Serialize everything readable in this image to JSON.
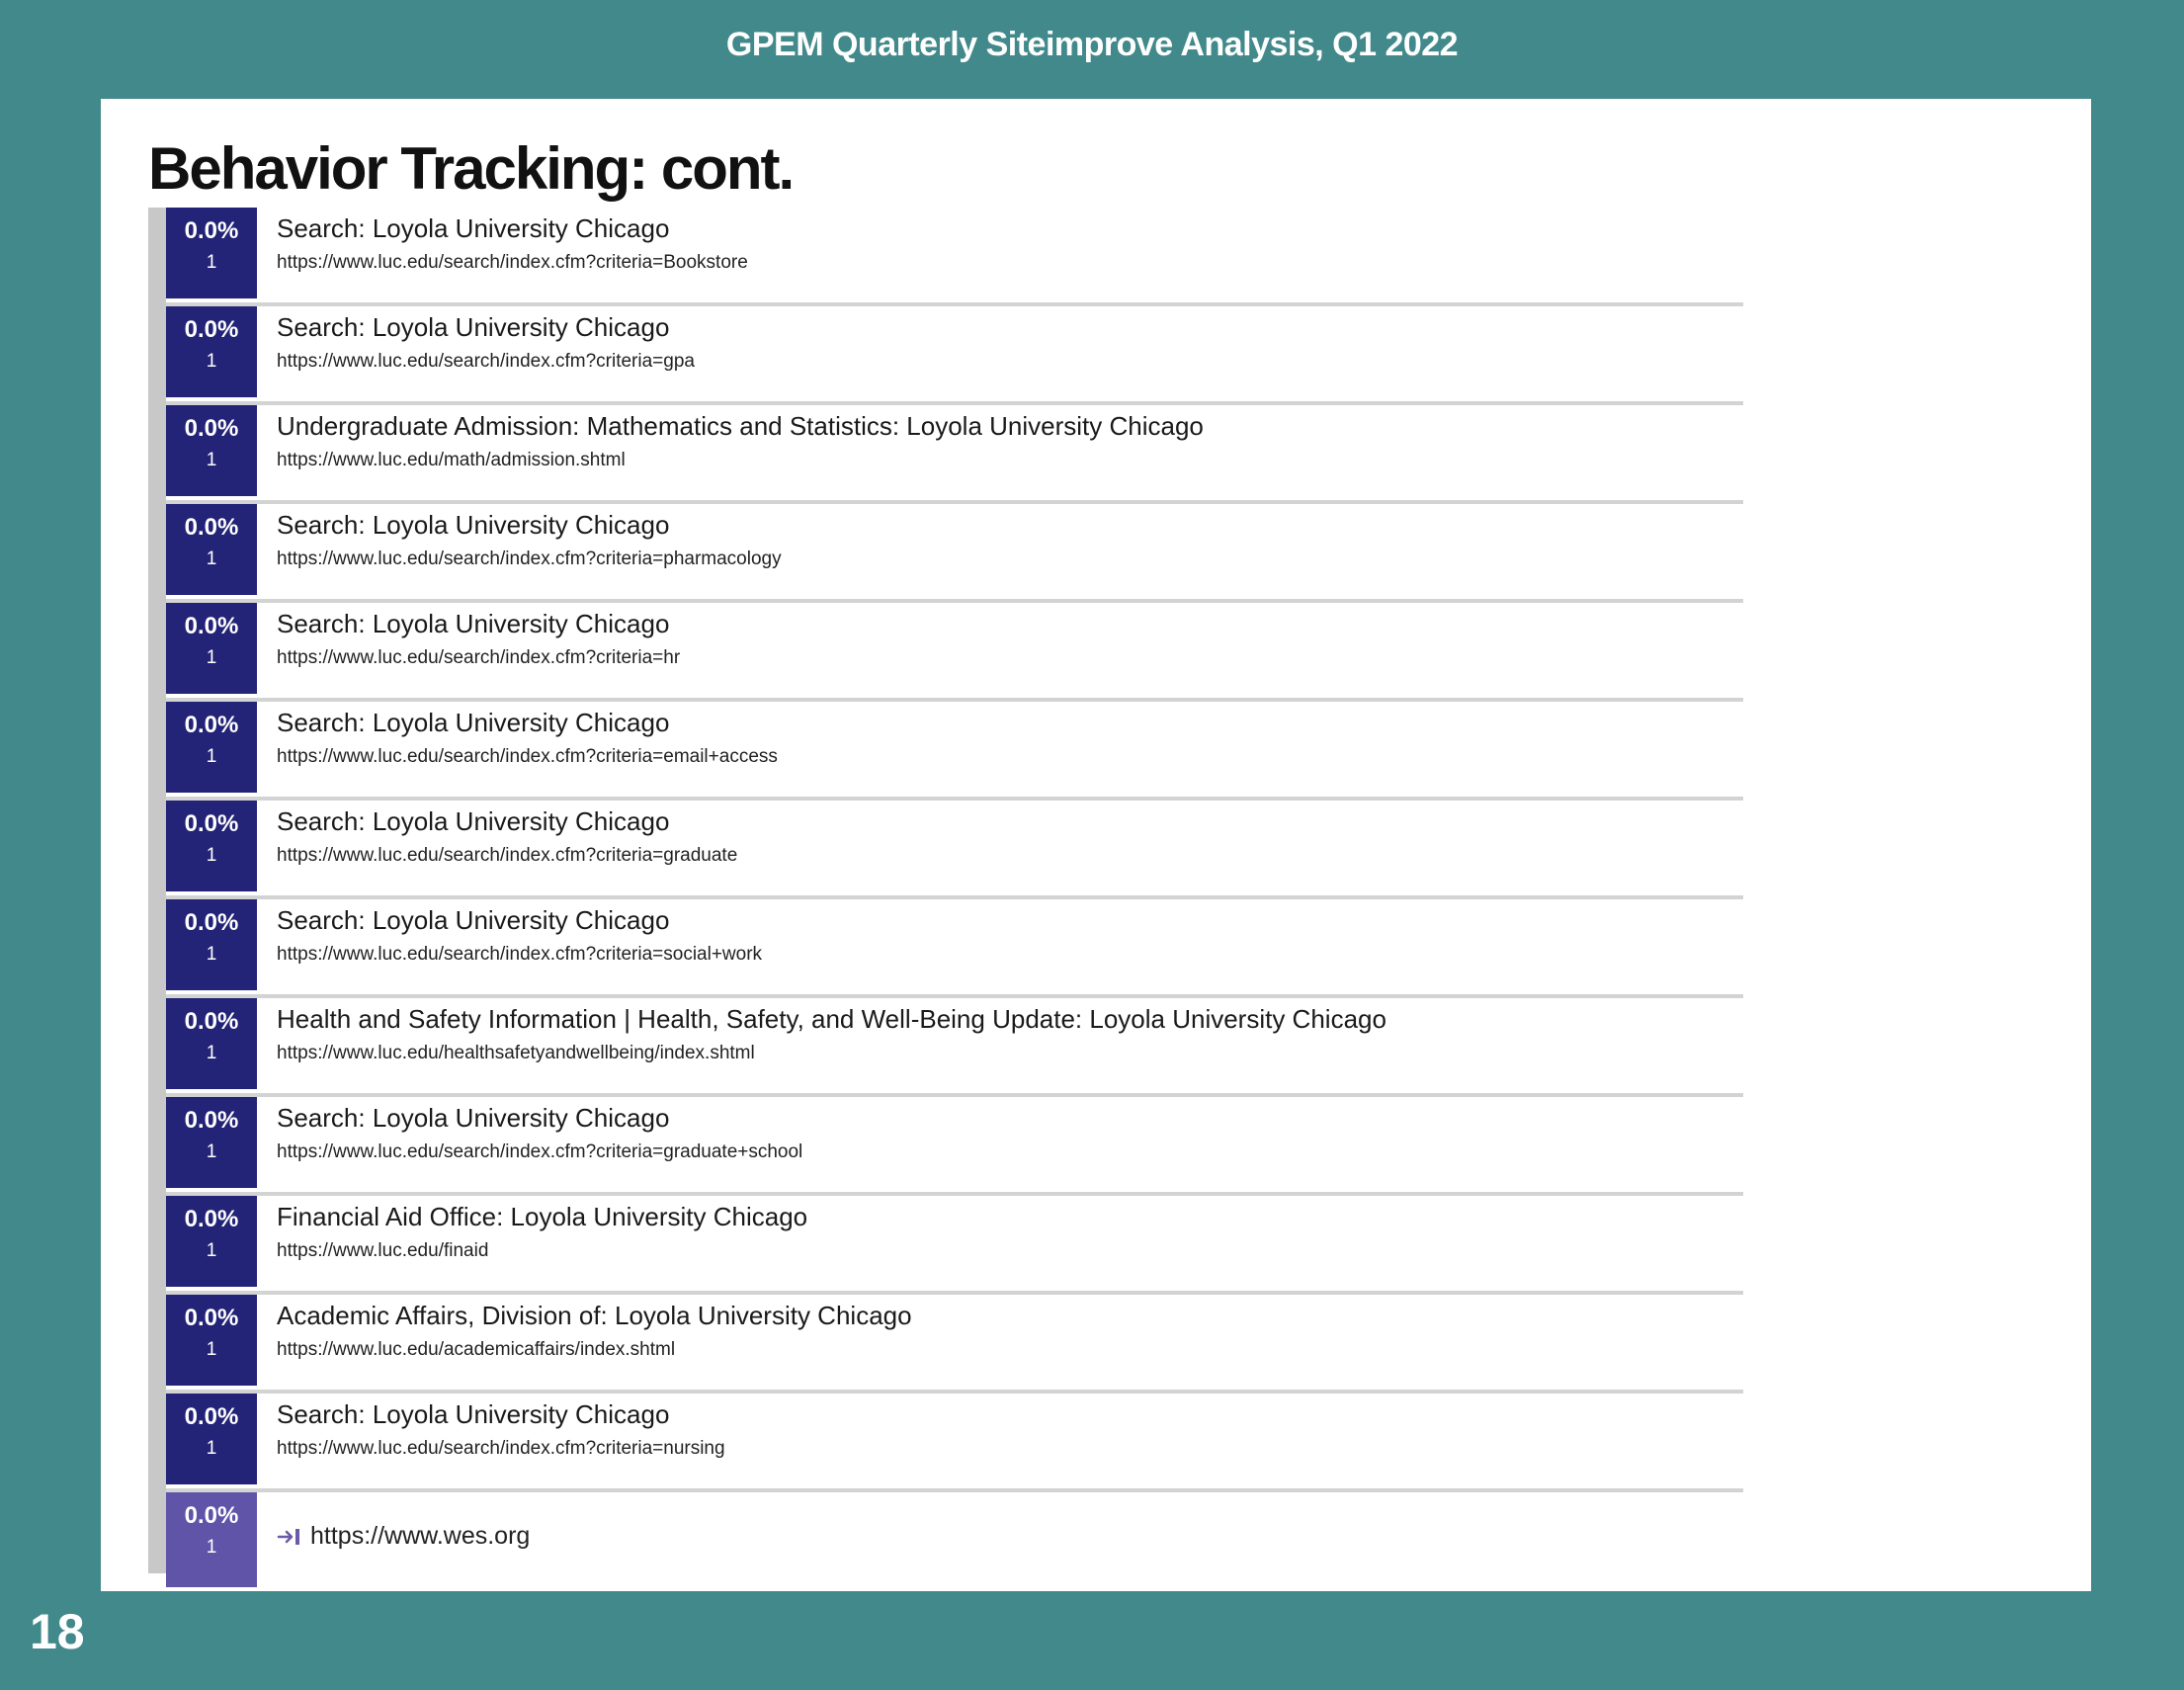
{
  "header": {
    "title": "GPEM Quarterly Siteimprove Analysis, Q1 2022"
  },
  "section": {
    "title": "Behavior Tracking: cont."
  },
  "page_number": "18",
  "colors": {
    "background": "#42898b",
    "stat_box": "#232377",
    "stat_box_external": "#6054a8"
  },
  "rows": [
    {
      "percent": "0.0%",
      "count": "1",
      "title": "Search: Loyola University Chicago",
      "url": "https://www.luc.edu/search/index.cfm?criteria=Bookstore"
    },
    {
      "percent": "0.0%",
      "count": "1",
      "title": "Search: Loyola University Chicago",
      "url": "https://www.luc.edu/search/index.cfm?criteria=gpa"
    },
    {
      "percent": "0.0%",
      "count": "1",
      "title": "Undergraduate Admission: Mathematics and Statistics: Loyola University Chicago",
      "url": "https://www.luc.edu/math/admission.shtml"
    },
    {
      "percent": "0.0%",
      "count": "1",
      "title": "Search: Loyola University Chicago",
      "url": "https://www.luc.edu/search/index.cfm?criteria=pharmacology"
    },
    {
      "percent": "0.0%",
      "count": "1",
      "title": "Search: Loyola University Chicago",
      "url": "https://www.luc.edu/search/index.cfm?criteria=hr"
    },
    {
      "percent": "0.0%",
      "count": "1",
      "title": "Search: Loyola University Chicago",
      "url": "https://www.luc.edu/search/index.cfm?criteria=email+access"
    },
    {
      "percent": "0.0%",
      "count": "1",
      "title": "Search: Loyola University Chicago",
      "url": "https://www.luc.edu/search/index.cfm?criteria=graduate"
    },
    {
      "percent": "0.0%",
      "count": "1",
      "title": "Search: Loyola University Chicago",
      "url": "https://www.luc.edu/search/index.cfm?criteria=social+work"
    },
    {
      "percent": "0.0%",
      "count": "1",
      "title": "Health and Safety Information | Health, Safety, and Well-Being Update: Loyola University Chicago",
      "url": "https://www.luc.edu/healthsafetyandwellbeing/index.shtml"
    },
    {
      "percent": "0.0%",
      "count": "1",
      "title": "Search: Loyola University Chicago",
      "url": "https://www.luc.edu/search/index.cfm?criteria=graduate+school"
    },
    {
      "percent": "0.0%",
      "count": "1",
      "title": "Financial Aid Office: Loyola University Chicago",
      "url": "https://www.luc.edu/finaid"
    },
    {
      "percent": "0.0%",
      "count": "1",
      "title": "Academic Affairs, Division of: Loyola University Chicago",
      "url": "https://www.luc.edu/academicaffairs/index.shtml"
    },
    {
      "percent": "0.0%",
      "count": "1",
      "title": "Search: Loyola University Chicago",
      "url": "https://www.luc.edu/search/index.cfm?criteria=nursing"
    }
  ],
  "external": {
    "percent": "0.0%",
    "count": "1",
    "url": "https://www.wes.org",
    "icon": "external-link-arrow-icon"
  }
}
